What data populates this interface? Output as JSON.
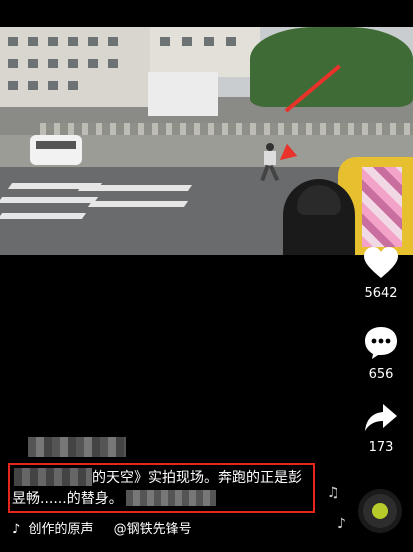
{
  "video": {
    "annotation_color": "#e8322a"
  },
  "actions": {
    "like_count": "5642",
    "comment_count": "656",
    "share_count": "173"
  },
  "caption": {
    "line1": "的天空》实拍现场。奔跑的正是彭",
    "line2": "昱畅......的替身。",
    "highlight_color": "#e5261d"
  },
  "music": {
    "note_glyph": "♪",
    "sound_label": "创作的原声",
    "author": "@钢铁先锋号"
  },
  "icons": {
    "like": "heart-icon",
    "comment": "comment-icon",
    "share": "share-icon",
    "music": "music-note-icon",
    "disc": "music-disc-icon"
  }
}
